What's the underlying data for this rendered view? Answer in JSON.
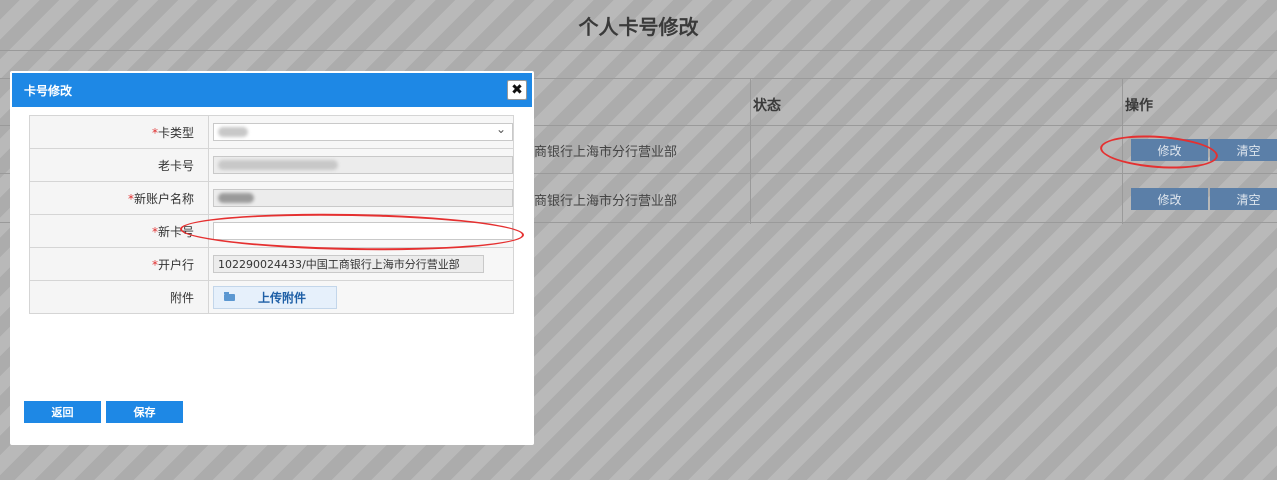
{
  "page": {
    "title": "个人卡号修改"
  },
  "table": {
    "headers": {
      "status": "状态",
      "action": "操作"
    },
    "rows": [
      {
        "bank": "商银行上海市分行营业部",
        "edit_label": "修改",
        "clear_label": "清空"
      },
      {
        "bank": "商银行上海市分行营业部",
        "edit_label": "修改",
        "clear_label": "清空"
      }
    ]
  },
  "dialog": {
    "title": "卡号修改",
    "close_symbol": "✖",
    "required_mark": "*",
    "fields": {
      "card_type": {
        "label": "卡类型",
        "value": ""
      },
      "old_card": {
        "label": "老卡号",
        "value": ""
      },
      "new_account_name": {
        "label": "新账户名称",
        "value": ""
      },
      "new_card": {
        "label": "新卡号",
        "value": ""
      },
      "bank": {
        "label": "开户行",
        "value": "102290024433/中国工商银行上海市分行营业部"
      },
      "attachment": {
        "label": "附件",
        "button": "上传附件"
      }
    },
    "buttons": {
      "back": "返回",
      "save": "保存"
    }
  },
  "colors": {
    "accent": "#1e88e5",
    "annotation": "#e53030",
    "bg_button": "#5b7fa8"
  }
}
